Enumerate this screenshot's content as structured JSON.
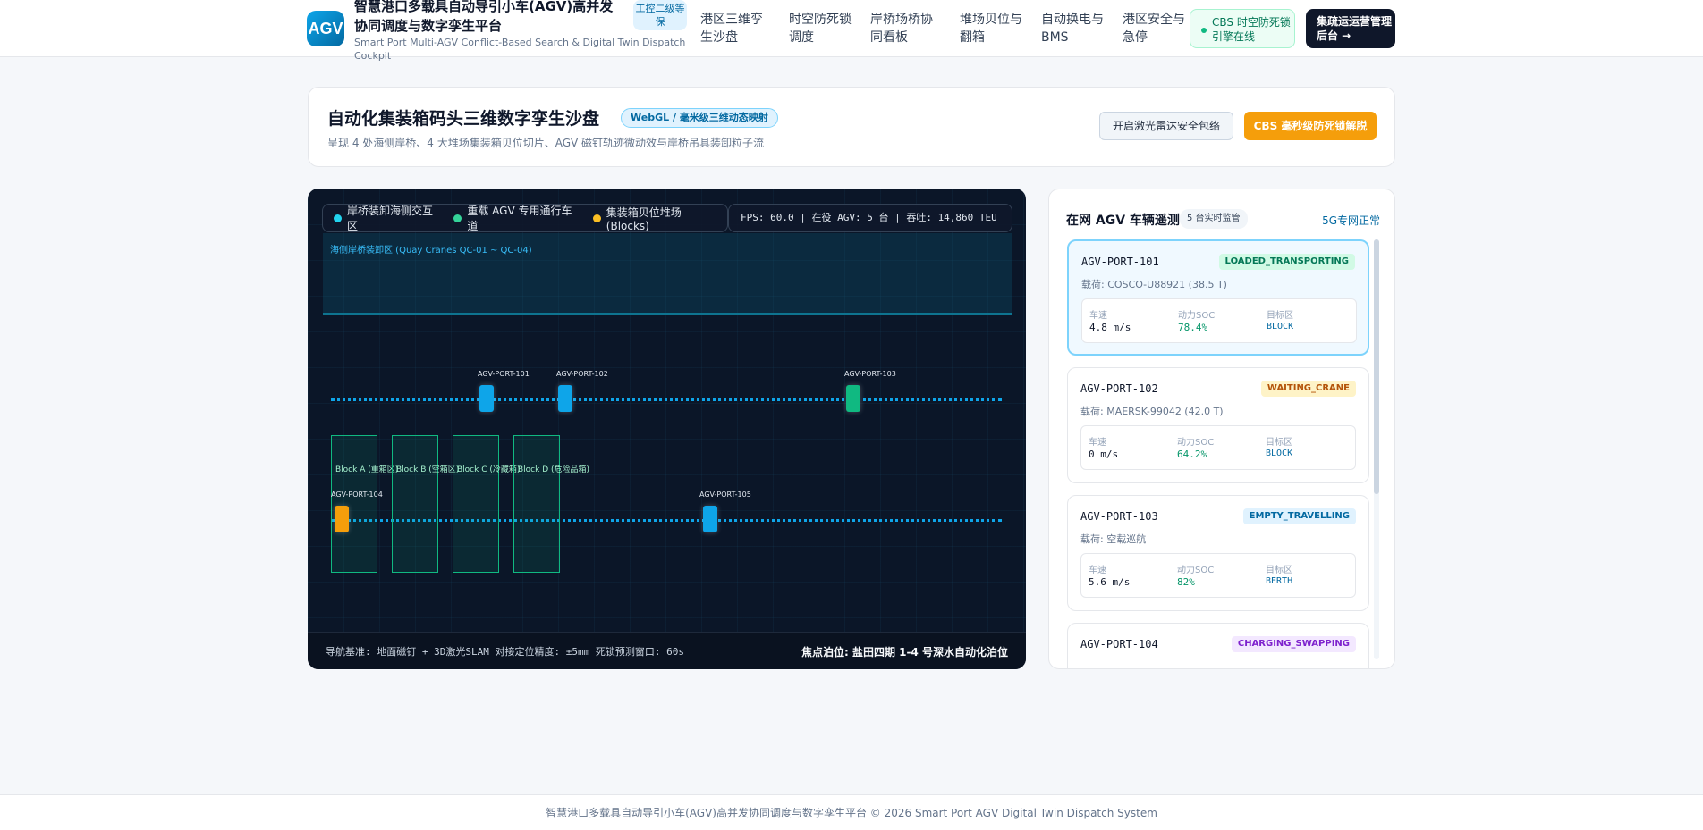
{
  "header": {
    "logo_text": "AGV",
    "title": "智慧港口多载具自动导引小车(AGV)高并发协同调度与数字孪生平台",
    "subtitle": "Smart Port Multi-AGV Conflict-Based Search & Digital Twin Dispatch Cockpit",
    "level_badge": "工控二级等保",
    "nav": [
      {
        "label": "港区三维孪生沙盘"
      },
      {
        "label": "时空防死锁调度"
      },
      {
        "label": "岸桥场桥协同看板"
      },
      {
        "label": "堆场贝位与翻箱"
      },
      {
        "label": "自动换电与BMS"
      },
      {
        "label": "港区安全与急停"
      }
    ],
    "cbs_status": "CBS 时空防死锁引擎在线",
    "admin_button": "集疏运运营管理后台 →"
  },
  "hero": {
    "title": "自动化集装箱码头三维数字孪生沙盘",
    "tag": "WebGL / 毫米级三维动态映射",
    "desc": "呈现 4 处海侧岸桥、4 大堆场集装箱贝位切片、AGV 磁钉轨迹微动效与岸桥吊具装卸粒子流",
    "radar_button": "开启激光雷达安全包络",
    "cbs_button": "CBS 毫秒级防死锁解脱"
  },
  "sandbox": {
    "legend": [
      {
        "label": "岸桥装卸海侧交互区",
        "color": "#22d3ee"
      },
      {
        "label": "重载 AGV 专用通行车道",
        "color": "#34d399"
      },
      {
        "label": "集装箱贝位堆场 (Blocks)",
        "color": "#fbbf24"
      }
    ],
    "stats": "FPS: 60.0 | 在役 AGV: 5 台 | 吞吐: 14,860 TEU",
    "quay_label": "海侧岸桥装卸区 (Quay Cranes QC-01 ~ QC-04)",
    "blocks": [
      {
        "label": "Block A (重箱区)"
      },
      {
        "label": "Block B (空箱区)"
      },
      {
        "label": "Block C (冷藏箱)"
      },
      {
        "label": "Block D (危险品箱)"
      }
    ],
    "agvs": [
      {
        "id": "AGV-PORT-101",
        "label": "AGV-PORT-101",
        "color": "#0ea5e9"
      },
      {
        "id": "AGV-PORT-102",
        "label": "AGV-PORT-102",
        "color": "#0ea5e9"
      },
      {
        "id": "AGV-PORT-103",
        "label": "AGV-PORT-103",
        "color": "#10b981"
      },
      {
        "id": "AGV-PORT-104",
        "label": "AGV-PORT-104",
        "color": "#f59e0b"
      },
      {
        "id": "AGV-PORT-105",
        "label": "AGV-PORT-105",
        "color": "#0ea5e9"
      }
    ],
    "footer_left": "导航基准: 地面磁钉 + 3D激光SLAM   对接定位精度: ±5mm   死锁预测窗口: 60s",
    "footer_right": "焦点泊位: 盐田四期 1-4 号深水自动化泊位"
  },
  "telemetry": {
    "title": "在网 AGV 车辆遥测",
    "count_badge": "5 台实时监管",
    "net_status": "5G专网正常",
    "metric_labels": {
      "speed": "车速",
      "soc": "动力SOC",
      "target": "目标区"
    },
    "vehicles": [
      {
        "id": "AGV-PORT-101",
        "status": "LOADED_TRANSPORTING",
        "status_color": "#047857",
        "status_bg": "#d1fae5",
        "cargo": "载荷: COSCO-U88921 (38.5 T)",
        "speed": "4.8 m/s",
        "soc": "78.4%",
        "target": "BLOCK"
      },
      {
        "id": "AGV-PORT-102",
        "status": "WAITING_CRANE",
        "status_color": "#b45309",
        "status_bg": "#fef3c7",
        "cargo": "载荷: MAERSK-99042 (42.0 T)",
        "speed": "0 m/s",
        "soc": "64.2%",
        "target": "BLOCK"
      },
      {
        "id": "AGV-PORT-103",
        "status": "EMPTY_TRAVELLING",
        "status_color": "#0369a1",
        "status_bg": "#e0f2fe",
        "cargo": "载荷: 空载巡航",
        "speed": "5.6 m/s",
        "soc": "82%",
        "target": "BERTH"
      },
      {
        "id": "AGV-PORT-104",
        "status": "CHARGING_SWAPPING",
        "status_color": "#7e22ce",
        "status_bg": "#f3e8ff",
        "cargo": "",
        "speed": "",
        "soc": "",
        "target": ""
      }
    ]
  },
  "footer": {
    "text": "智慧港口多载具自动导引小车(AGV)高并发协同调度与数字孪生平台 © 2026 Smart Port AGV Digital Twin Dispatch System"
  }
}
